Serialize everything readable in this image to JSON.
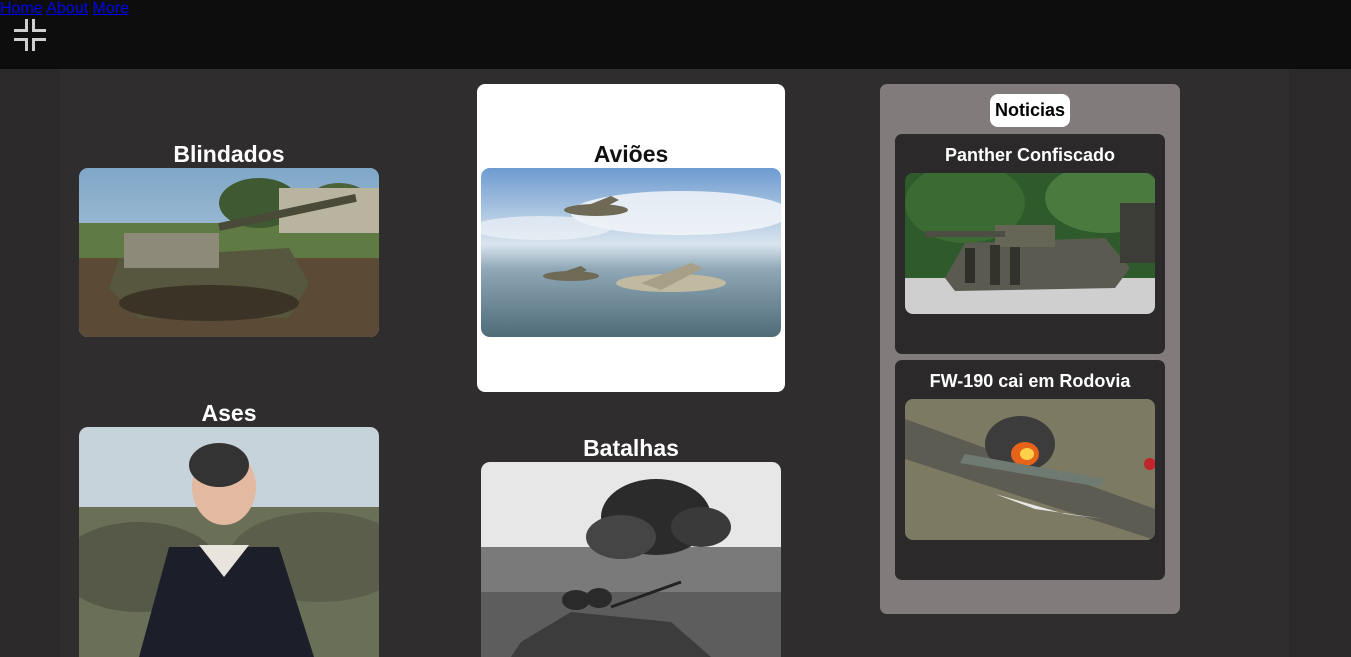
{
  "nav": {
    "logo_icon": "cross-logo-icon",
    "items": [
      "Home",
      "About",
      "More"
    ]
  },
  "categories": {
    "blindados": {
      "title": "Blindados",
      "image": "tank-image"
    },
    "avioes": {
      "title": "Aviões",
      "image": "planes-image"
    },
    "ases": {
      "title": "Ases",
      "image": "tank-ace-image"
    },
    "batalhas": {
      "title": "Batalhas",
      "image": "battle-image"
    }
  },
  "news": {
    "header": "Noticias",
    "items": [
      {
        "title": "Panther Confiscado",
        "image": "panther-image"
      },
      {
        "title": "FW-190 cai em Rodovia",
        "image": "crash-image"
      }
    ]
  },
  "colors": {
    "topbar": "#0d0d0d",
    "page_bg": "#2b292a",
    "news_panel": "#817b7c"
  }
}
